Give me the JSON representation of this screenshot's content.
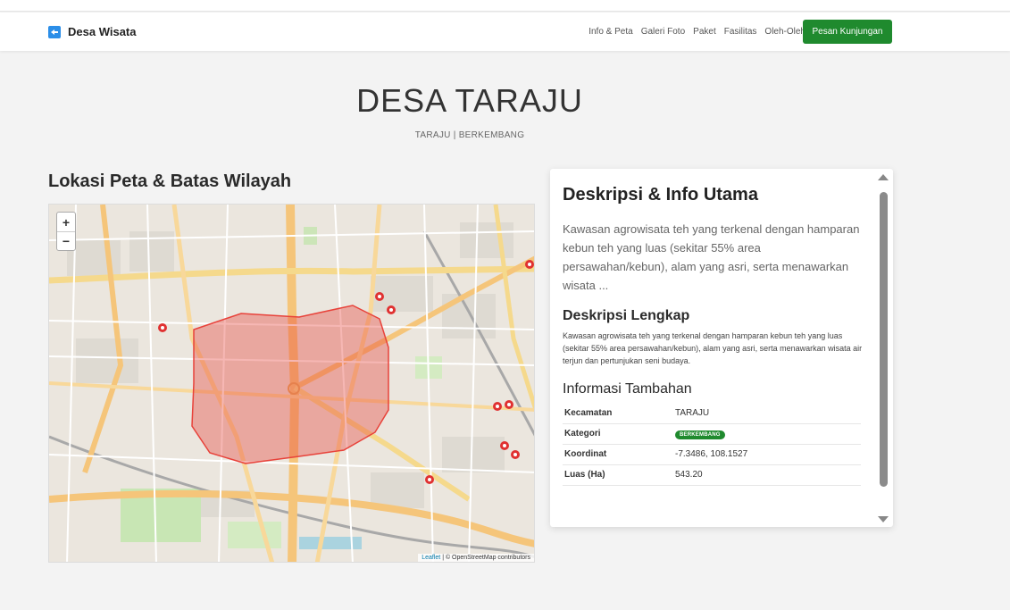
{
  "navbar": {
    "brand": "Desa Wisata",
    "links": [
      "Info & Peta",
      "Galeri Foto",
      "Paket",
      "Fasilitas",
      "Oleh-Oleh"
    ],
    "cta": "Pesan Kunjungan",
    "accent_color": "#1f8a2e"
  },
  "hero": {
    "title": "DESA TARAJU",
    "subtitle": "TARAJU | BERKEMBANG"
  },
  "map_section": {
    "heading": "Lokasi Peta & Batas Wilayah",
    "zoom_in": "+",
    "zoom_out": "−",
    "attribution_leaflet": "Leaflet",
    "attribution_rest": " | © OpenStreetMap contributors",
    "polygon_color": "#e8423a"
  },
  "info_card": {
    "title": "Deskripsi & Info Utama",
    "summary": "Kawasan agrowisata teh yang terkenal dengan hamparan kebun teh yang luas (sekitar 55% area persawahan/kebun), alam yang asri, serta menawarkan wisata ...",
    "full_title": "Deskripsi Lengkap",
    "full_text": "Kawasan agrowisata teh yang terkenal dengan hamparan kebun teh yang luas (sekitar 55% area persawahan/kebun), alam yang asri, serta menawarkan wisata air terjun dan pertunjukan seni budaya.",
    "extra_title": "Informasi Tambahan",
    "rows": [
      {
        "label": "Kecamatan",
        "value": "TARAJU"
      },
      {
        "label": "Kategori",
        "value": "BERKEMBANG"
      },
      {
        "label": "Koordinat",
        "value": "-7.3486, 108.1527"
      },
      {
        "label": "Luas (Ha)",
        "value": "543.20"
      }
    ]
  }
}
